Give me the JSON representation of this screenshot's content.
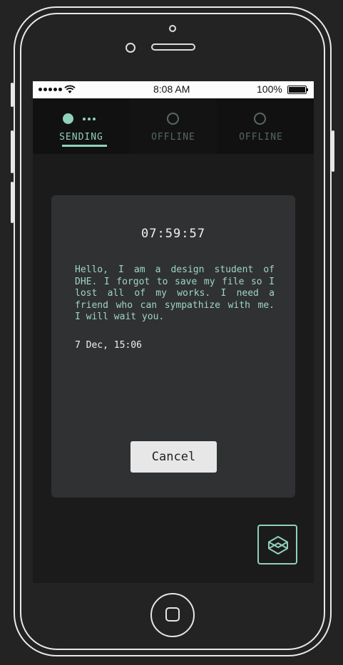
{
  "status_bar": {
    "carrier_dots": 5,
    "time": "8:08 AM",
    "battery": "100%"
  },
  "tabs": [
    {
      "label": "SENDING",
      "state": "active"
    },
    {
      "label": "OFFLINE",
      "state": "inactive"
    },
    {
      "label": "OFFLINE",
      "state": "inactive"
    }
  ],
  "card": {
    "timer": "07:59:57",
    "message": "Hello, I am a design student of DHE. I forgot to save my file so I lost all of my works. I need a friend who can sympathize with me. I will wait you.",
    "date": "7 Dec, 15:06",
    "cancel_label": "Cancel"
  },
  "colors": {
    "accent": "#8fd1bd",
    "background": "#1c1b1c",
    "card": "#303133"
  },
  "icons": {
    "fab": "cube-icon"
  }
}
